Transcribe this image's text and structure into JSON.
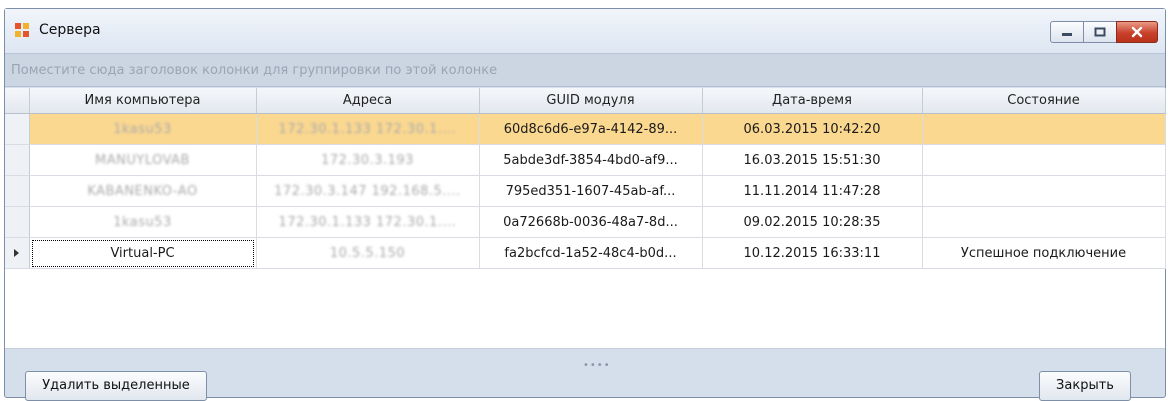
{
  "window": {
    "title": "Сервера",
    "controls": [
      "minimize",
      "maximize",
      "close"
    ]
  },
  "group_panel": {
    "hint": "Поместите сюда заголовок колонки для группировки по этой колонке"
  },
  "grid": {
    "columns": [
      "Имя компьютера",
      "Адреса",
      "GUID модуля",
      "Дата-время",
      "Состояние"
    ],
    "rows": [
      {
        "name": "1kasu53",
        "addresses": "172.30.1.133 172.30.1....",
        "guid": "60d8c6d6-e97a-4142-89...",
        "datetime": "06.03.2015 10:42:20",
        "state": "",
        "selected": true,
        "current": false,
        "name_redacted": true,
        "addr_redacted": true
      },
      {
        "name": "MANUYLOVAB",
        "addresses": "172.30.3.193",
        "guid": "5abde3df-3854-4bd0-af9...",
        "datetime": "16.03.2015 15:51:30",
        "state": "",
        "selected": false,
        "current": false,
        "name_redacted": true,
        "addr_redacted": true
      },
      {
        "name": "KABANENKO-AO",
        "addresses": "172.30.3.147 192.168.5....",
        "guid": "795ed351-1607-45ab-af...",
        "datetime": "11.11.2014 11:47:28",
        "state": "",
        "selected": false,
        "current": false,
        "name_redacted": true,
        "addr_redacted": true
      },
      {
        "name": "1kasu53",
        "addresses": "172.30.1.133 172.30.1....",
        "guid": "0a72668b-0036-48a7-8d...",
        "datetime": "09.02.2015 10:28:35",
        "state": "",
        "selected": false,
        "current": false,
        "name_redacted": true,
        "addr_redacted": true
      },
      {
        "name": "Virtual-PC",
        "addresses": "10.5.5.150",
        "guid": "fa2bcfcd-1a52-48c4-b0d...",
        "datetime": "10.12.2015 16:33:11",
        "state": "Успешное подключение",
        "selected": false,
        "current": true,
        "name_redacted": false,
        "addr_redacted": true
      }
    ]
  },
  "buttons": {
    "delete_label": "Удалить выделенные",
    "close_label": "Закрыть"
  },
  "colors": {
    "selection": "#fbd890",
    "window_frame": "#d5dfec",
    "close_button": "#c9412b"
  }
}
